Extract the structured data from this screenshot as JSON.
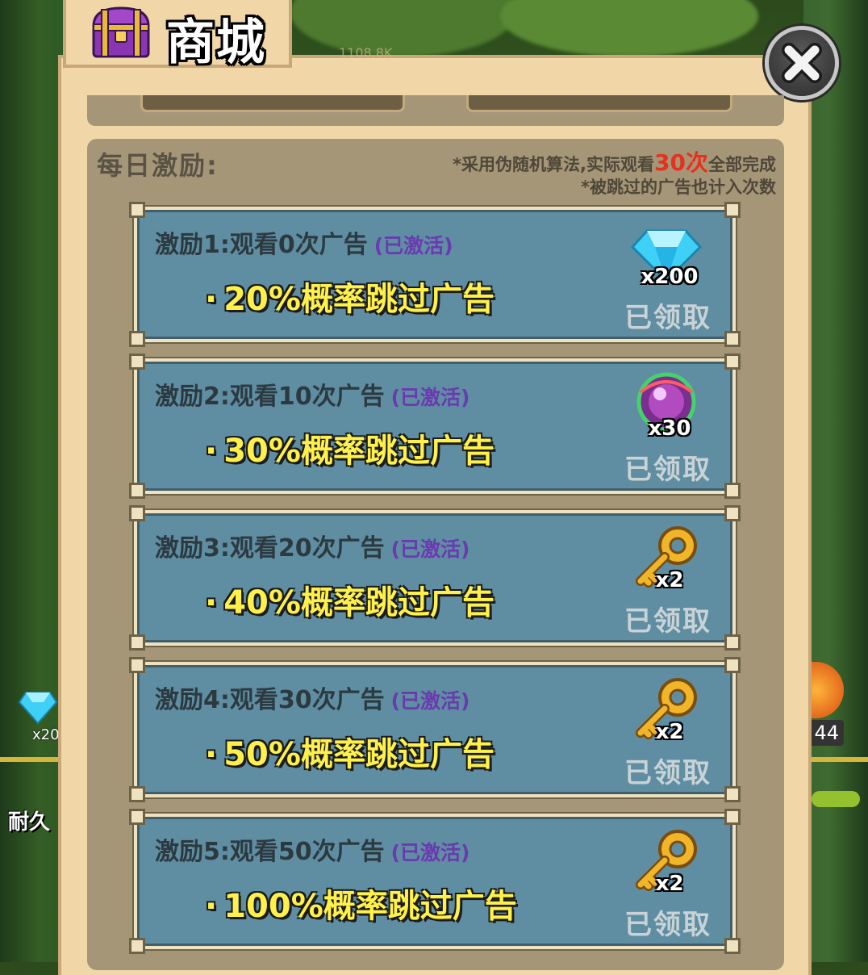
{
  "shop": {
    "title": "商城",
    "faint_number": "1108.8K"
  },
  "section": {
    "title": "每日激励:",
    "note_prefix": "*采用伪随机算法,实际观看",
    "note_highlight": "30次",
    "note_suffix": "全部完成",
    "note_line2": "*被跳过的广告也计入次数"
  },
  "cards": [
    {
      "head": "激励1:观看0次广告",
      "state": "(已激活)",
      "bullet": "20%概率跳过广告",
      "reward_icon": "diamond-icon",
      "reward_count": "x200",
      "status": "已领取"
    },
    {
      "head": "激励2:观看10次广告",
      "state": "(已激活)",
      "bullet": "30%概率跳过广告",
      "reward_icon": "orb-icon",
      "reward_count": "x30",
      "status": "已领取"
    },
    {
      "head": "激励3:观看20次广告",
      "state": "(已激活)",
      "bullet": "40%概率跳过广告",
      "reward_icon": "key-icon",
      "reward_count": "x2",
      "status": "已领取"
    },
    {
      "head": "激励4:观看30次广告",
      "state": "(已激活)",
      "bullet": "50%概率跳过广告",
      "reward_icon": "key-icon",
      "reward_count": "x2",
      "status": "已领取"
    },
    {
      "head": "激励5:观看50次广告",
      "state": "(已激活)",
      "bullet": "100%概率跳过广告",
      "reward_icon": "key-icon",
      "reward_count": "x2",
      "status": "已领取"
    }
  ],
  "background": {
    "gem_label": "x20",
    "durability_label": "耐久",
    "right_count": "44"
  },
  "colors": {
    "panel_bg": "#f1d6a8",
    "section_bg": "#a59678",
    "card_bg": "#5f8ea3",
    "bullet_text": "#fff14a",
    "state_text": "#6a3ab0",
    "highlight": "#e8301c"
  }
}
